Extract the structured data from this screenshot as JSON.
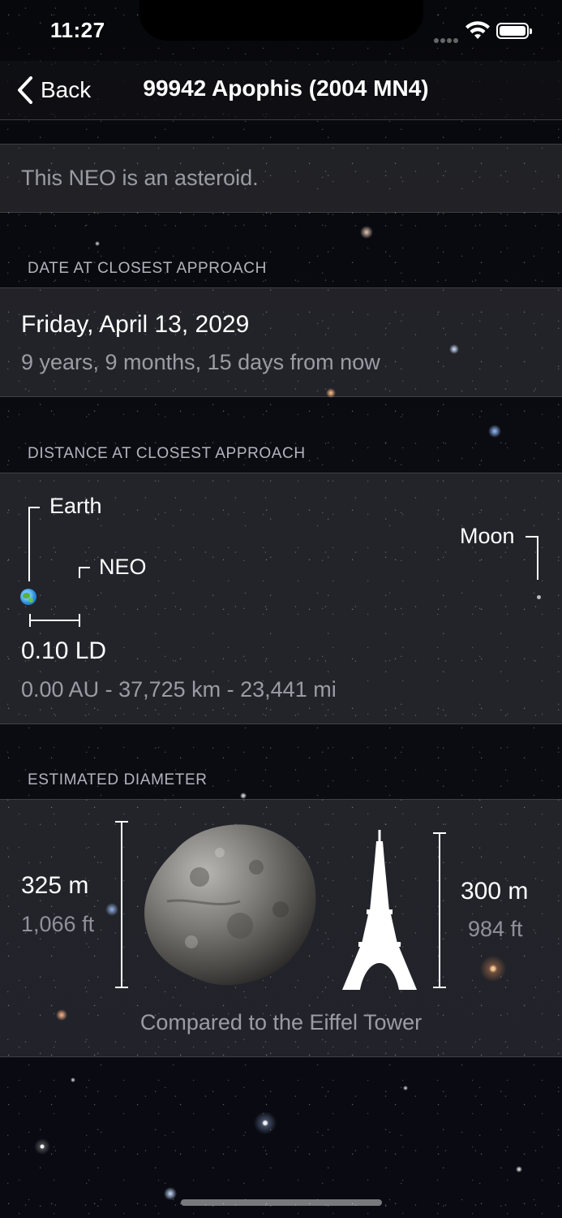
{
  "status_bar": {
    "time": "11:27",
    "icons": [
      "signal-dots-icon",
      "wifi-icon",
      "battery-icon"
    ]
  },
  "nav": {
    "back_label": "Back",
    "title": "99942 Apophis (2004 MN4)"
  },
  "type_cell": {
    "text": "This NEO is an asteroid."
  },
  "date_section": {
    "header": "DATE AT CLOSEST APPROACH",
    "date": "Friday, April 13, 2029",
    "relative": "9 years, 9 months, 15 days from now"
  },
  "distance_section": {
    "header": "DISTANCE AT CLOSEST APPROACH",
    "earth_label": "Earth",
    "neo_label": "NEO",
    "moon_label": "Moon",
    "distance_ld": "0.10 LD",
    "distance_detail": "0.00 AU - 37,725 km - 23,441 mi"
  },
  "diameter_section": {
    "header": "ESTIMATED DIAMETER",
    "neo_size_m": "325 m",
    "neo_size_ft": "1,066 ft",
    "tower_size_m": "300 m",
    "tower_size_ft": "984 ft",
    "caption": "Compared to the Eiffel Tower"
  },
  "colors": {
    "background": "#0a0b10",
    "cell_fill": "rgba(255,255,255,0.10)",
    "text_primary": "#ffffff",
    "text_secondary": "rgba(235,235,245,0.6)"
  }
}
